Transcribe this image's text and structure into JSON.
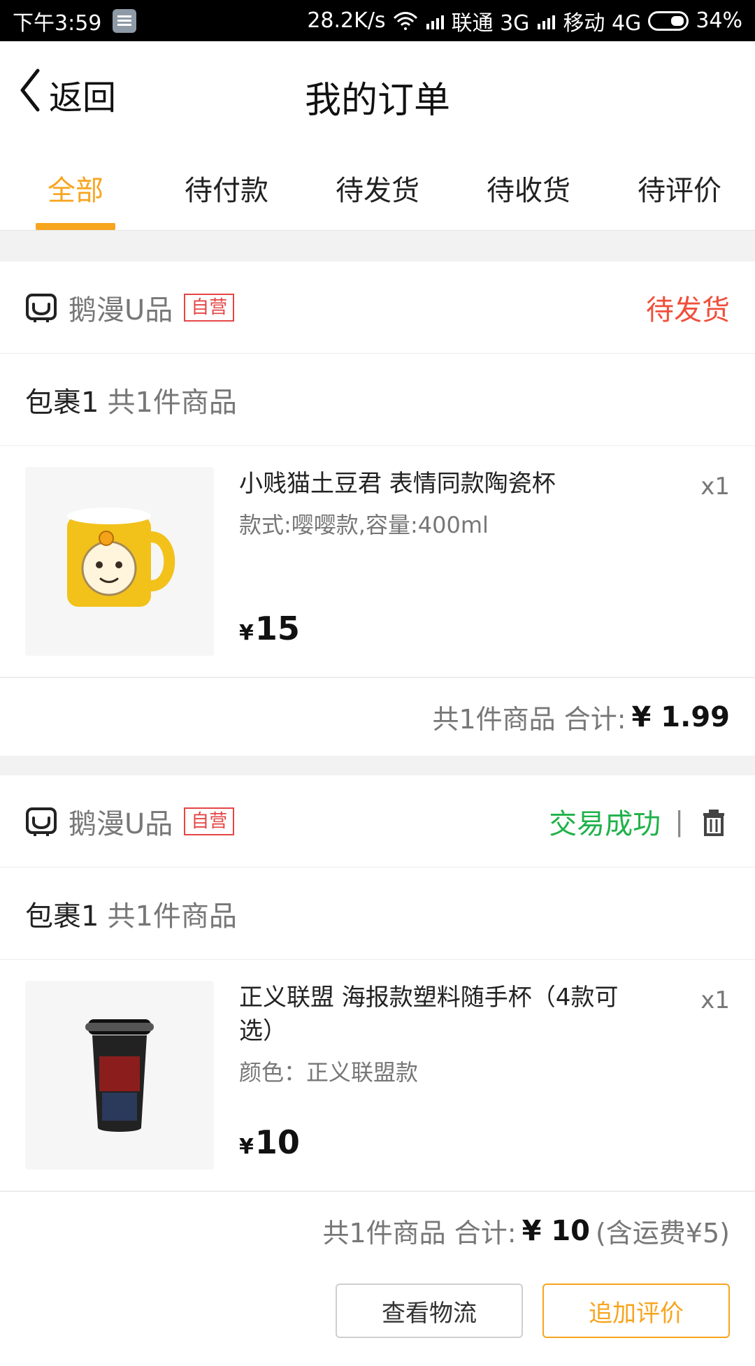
{
  "status_bar": {
    "time": "下午3:59",
    "network_speed": "28.2K/s",
    "carrier1": "联通 3G",
    "carrier2": "移动 4G",
    "battery": "34%"
  },
  "header": {
    "back_label": "返回",
    "title": "我的订单"
  },
  "tabs": [
    {
      "label": "全部",
      "active": true
    },
    {
      "label": "待付款",
      "active": false
    },
    {
      "label": "待发货",
      "active": false
    },
    {
      "label": "待收货",
      "active": false
    },
    {
      "label": "待评价",
      "active": false
    }
  ],
  "orders": [
    {
      "shop": {
        "name": "鹅漫U品",
        "badge": "自营"
      },
      "status": "待发货",
      "package": {
        "title": "包裹1",
        "count": "共1件商品"
      },
      "item": {
        "name": "小贱猫土豆君 表情同款陶瓷杯",
        "spec": "款式:嘤嘤款,容量:400ml",
        "currency": "¥",
        "price": "15",
        "qty": "x1"
      },
      "total": {
        "label": "共1件商品 合计:",
        "amount": "¥ 1.99",
        "extra": ""
      }
    },
    {
      "shop": {
        "name": "鹅漫U品",
        "badge": "自营"
      },
      "status": "交易成功",
      "separator": "|",
      "package": {
        "title": "包裹1",
        "count": "共1件商品"
      },
      "item": {
        "name": "正义联盟 海报款塑料随手杯（4款可选）",
        "spec": "颜色：正义联盟款",
        "currency": "¥",
        "price": "10",
        "qty": "x1"
      },
      "total": {
        "label": "共1件商品 合计:",
        "amount": "¥ 10",
        "extra": "(含运费¥5)"
      },
      "actions": [
        {
          "label": "查看物流"
        },
        {
          "label": "追加评价"
        }
      ]
    }
  ],
  "colors": {
    "accent": "#f7a51f",
    "status_pending": "#f04f3b",
    "status_success": "#20b24a",
    "badge": "#e54545"
  }
}
